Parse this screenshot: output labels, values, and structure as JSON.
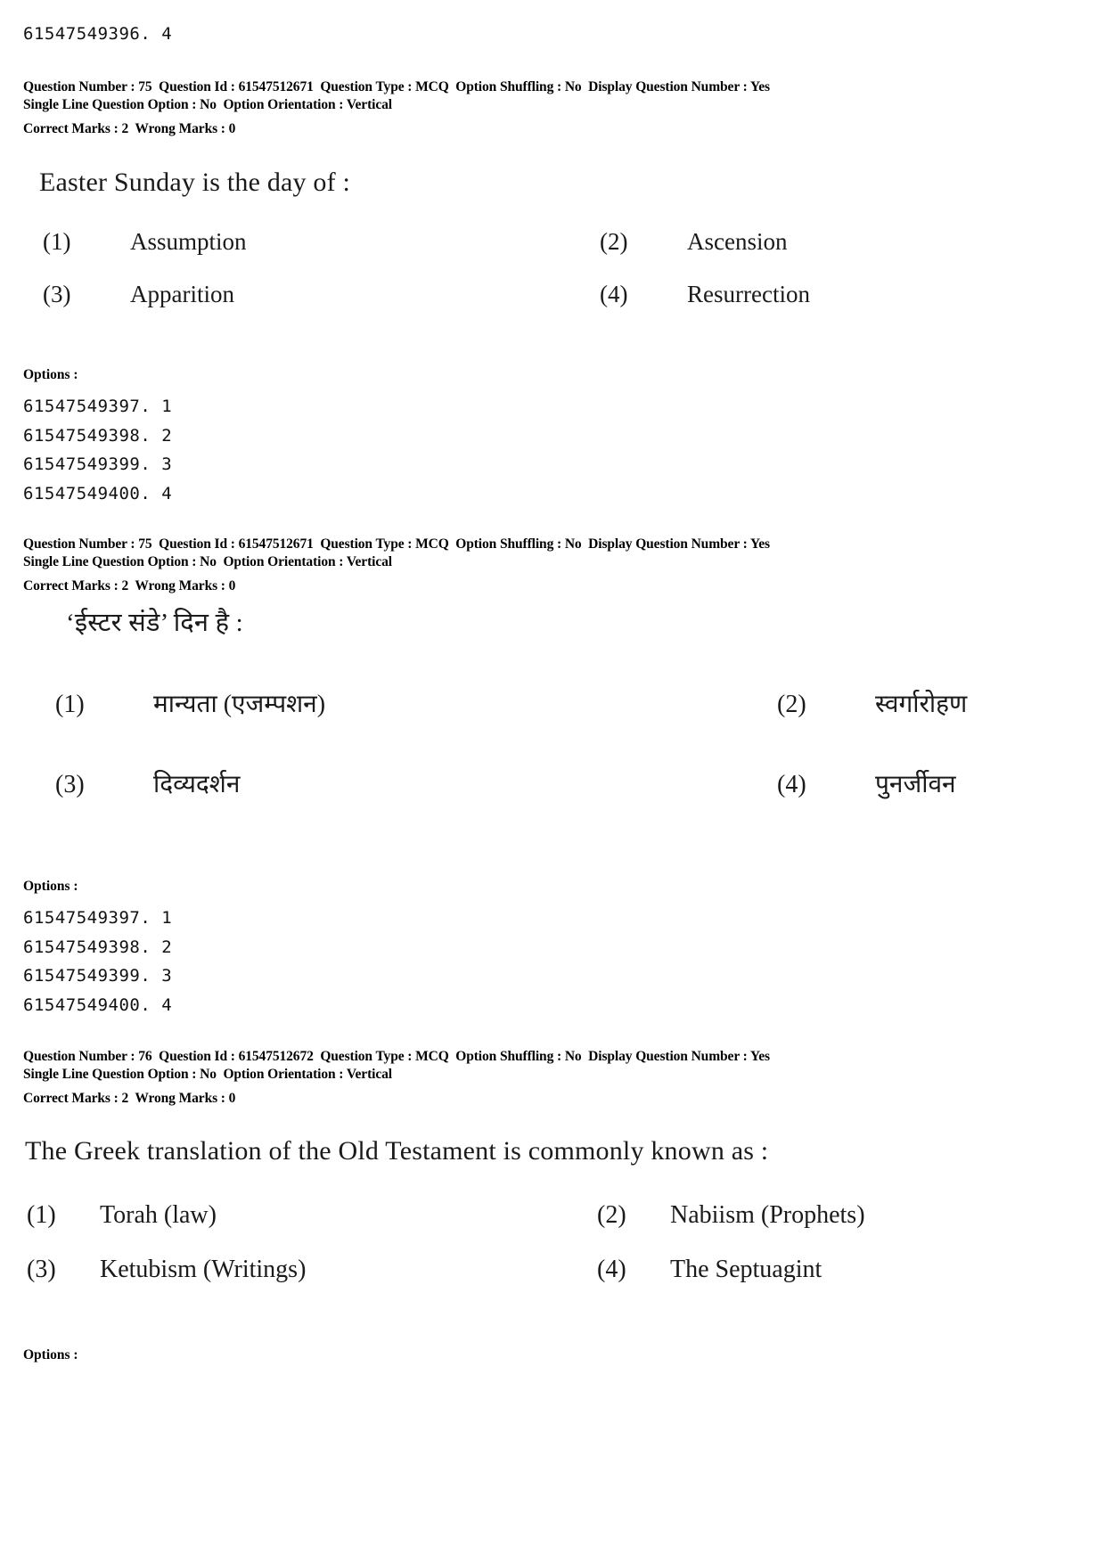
{
  "page": {
    "top_option_id": "61547549396. 4"
  },
  "questions": [
    {
      "meta": {
        "question_number_label": "Question Number :",
        "question_number": "75",
        "question_id_label": "Question Id :",
        "question_id": "61547512671",
        "question_type_label": "Question Type :",
        "question_type": "MCQ",
        "option_shuffling_label": "Option Shuffling :",
        "option_shuffling": "No",
        "display_question_number_label": "Display Question Number :",
        "display_question_number": "Yes",
        "single_line_question_option_label": "Single Line Question Option :",
        "single_line_question_option": "No",
        "option_orientation_label": "Option Orientation :",
        "option_orientation": "Vertical",
        "correct_marks_label": "Correct Marks :",
        "correct_marks": "2",
        "wrong_marks_label": "Wrong Marks :",
        "wrong_marks": "0"
      },
      "stem": "Easter Sunday is the day of :",
      "options": [
        {
          "num": "(1)",
          "text": "Assumption"
        },
        {
          "num": "(2)",
          "text": "Ascension"
        },
        {
          "num": "(3)",
          "text": "Apparition"
        },
        {
          "num": "(4)",
          "text": "Resurrection"
        }
      ],
      "options_label": "Options :",
      "option_ids": [
        "61547549397. 1",
        "61547549398. 2",
        "61547549399. 3",
        "61547549400. 4"
      ]
    },
    {
      "meta": {
        "question_number_label": "Question Number :",
        "question_number": "75",
        "question_id_label": "Question Id :",
        "question_id": "61547512671",
        "question_type_label": "Question Type :",
        "question_type": "MCQ",
        "option_shuffling_label": "Option Shuffling :",
        "option_shuffling": "No",
        "display_question_number_label": "Display Question Number :",
        "display_question_number": "Yes",
        "single_line_question_option_label": "Single Line Question Option :",
        "single_line_question_option": "No",
        "option_orientation_label": "Option Orientation :",
        "option_orientation": "Vertical",
        "correct_marks_label": "Correct Marks :",
        "correct_marks": "2",
        "wrong_marks_label": "Wrong Marks :",
        "wrong_marks": "0"
      },
      "stem": "‘ईस्टर संडे’ दिन है :",
      "options": [
        {
          "num": "(1)",
          "text": "मान्यता (एजम्पशन)"
        },
        {
          "num": "(2)",
          "text": "स्वर्गारोहण"
        },
        {
          "num": "(3)",
          "text": "दिव्यदर्शन"
        },
        {
          "num": "(4)",
          "text": "पुनर्जीवन"
        }
      ],
      "options_label": "Options :",
      "option_ids": [
        "61547549397. 1",
        "61547549398. 2",
        "61547549399. 3",
        "61547549400. 4"
      ]
    },
    {
      "meta": {
        "question_number_label": "Question Number :",
        "question_number": "76",
        "question_id_label": "Question Id :",
        "question_id": "61547512672",
        "question_type_label": "Question Type :",
        "question_type": "MCQ",
        "option_shuffling_label": "Option Shuffling :",
        "option_shuffling": "No",
        "display_question_number_label": "Display Question Number :",
        "display_question_number": "Yes",
        "single_line_question_option_label": "Single Line Question Option :",
        "single_line_question_option": "No",
        "option_orientation_label": "Option Orientation :",
        "option_orientation": "Vertical",
        "correct_marks_label": "Correct Marks :",
        "correct_marks": "2",
        "wrong_marks_label": "Wrong Marks :",
        "wrong_marks": "0"
      },
      "stem": "The Greek translation of the Old Testament is commonly known as :",
      "options": [
        {
          "num": "(1)",
          "text": "Torah (law)"
        },
        {
          "num": "(2)",
          "text": "Nabiism (Prophets)"
        },
        {
          "num": "(3)",
          "text": "Ketubism (Writings)"
        },
        {
          "num": "(4)",
          "text": "The Septuagint"
        }
      ],
      "options_label": "Options :",
      "option_ids": []
    }
  ]
}
